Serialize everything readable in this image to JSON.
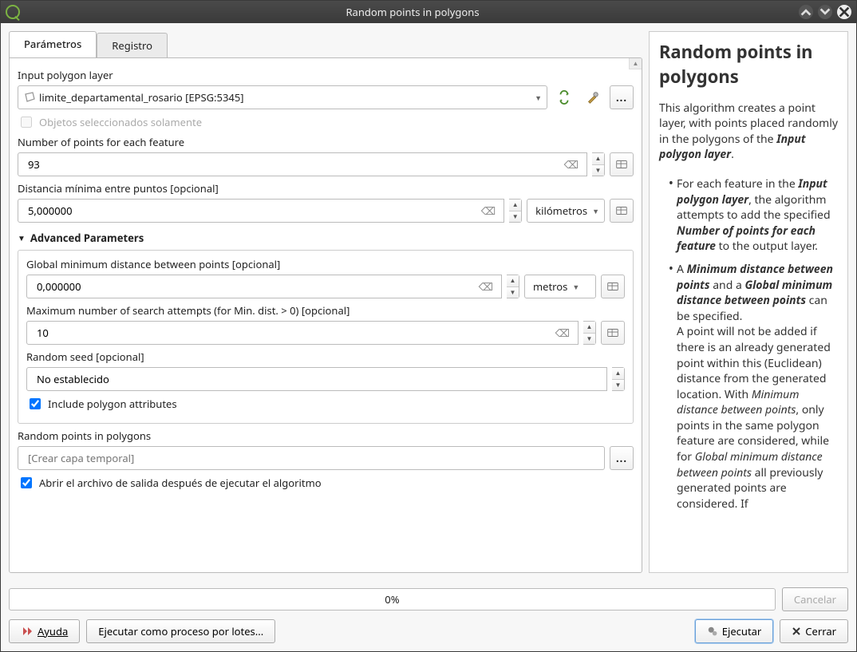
{
  "window": {
    "title": "Random points in polygons"
  },
  "tabs": {
    "parameters": "Parámetros",
    "log": "Registro"
  },
  "labels": {
    "input_polygon": "Input polygon layer",
    "selected_only": "Objetos seleccionados solamente",
    "num_points": "Number of points for each feature",
    "min_distance": "Distancia mínima entre puntos [opcional]",
    "advanced": "Advanced Parameters",
    "global_min": "Global minimum distance between points [opcional]",
    "max_attempts": "Maximum number of search attempts (for Min. dist. > 0) [opcional]",
    "random_seed": "Random seed [opcional]",
    "include_attrs": "Include polygon attributes",
    "output_layer": "Random points in polygons",
    "open_output": "Abrir el archivo de salida después de ejecutar el algoritmo"
  },
  "values": {
    "input_polygon": "limite_departamental_rosario [EPSG:5345]",
    "num_points": "93",
    "min_distance": "5,000000",
    "min_distance_unit": "kilómetros",
    "global_min": "0,000000",
    "global_min_unit": "metros",
    "max_attempts": "10",
    "random_seed": "No establecido",
    "output_placeholder": "[Crear capa temporal]"
  },
  "progress": {
    "text": "0%"
  },
  "buttons": {
    "cancel": "Cancelar",
    "help": "Ayuda",
    "batch": "Ejecutar como proceso por lotes...",
    "run": "Ejecutar",
    "close": "Cerrar"
  },
  "help": {
    "title": "Random points in polygons",
    "intro1": "This algorithm creates a point layer, with points placed randomly in the polygons of the ",
    "intro2_bold": "Input polygon layer",
    "period": ".",
    "b1_a": "For each feature in the ",
    "b1_b": "Input polygon layer",
    "b1_c": ", the algorithm attempts to add the specified ",
    "b1_d": "Number of points for each feature",
    "b1_e": " to the output layer.",
    "b2_a": "A ",
    "b2_b": "Minimum distance between points",
    "b2_c": " and a ",
    "b2_d": "Global minimum distance between points",
    "b2_e": " can be specified.",
    "b2_f": "A point will not be added if there is an already generated point within this (Euclidean) distance from the generated location. With ",
    "b2_g": "Minimum distance between points",
    "b2_h": ", only points in the same polygon feature are considered, while for ",
    "b2_i": "Global minimum distance between points",
    "b2_j": " all previously generated points are considered. If"
  }
}
